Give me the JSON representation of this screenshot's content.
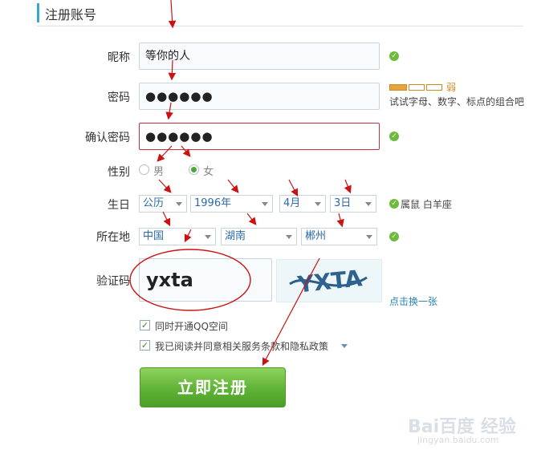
{
  "page_title": "注册账号",
  "fields": {
    "nickname": {
      "label": "昵称",
      "value": "等你的人"
    },
    "password": {
      "label": "密码",
      "value": "●●●●●●",
      "strength": "弱",
      "hint": "试试字母、数字、标点的组合吧"
    },
    "confirm": {
      "label": "确认密码",
      "value": "●●●●●●"
    },
    "gender": {
      "label": "性别",
      "options": [
        "男",
        "女"
      ],
      "selected": "女"
    },
    "birthday": {
      "label": "生日",
      "calendar": "公历",
      "year": "1996年",
      "month": "4月",
      "day": "3日",
      "zodiac": "属鼠 白羊座"
    },
    "location": {
      "label": "所在地",
      "country": "中国",
      "province": "湖南",
      "city": "郴州"
    },
    "captcha": {
      "label": "验证码",
      "value": "yxta",
      "image_text": "YXTA",
      "refresh": "点击换一张"
    }
  },
  "checkboxes": [
    {
      "label": "同时开通QQ空间",
      "checked": true
    },
    {
      "label": "我已阅读并同意相关服务条款和隐私政策",
      "checked": true
    }
  ],
  "submit_label": "立即注册",
  "watermark": {
    "brand": "Bai百度 经验",
    "url": "jingyan.baidu.com"
  },
  "colors": {
    "accent": "#3aa3d8",
    "ok": "#6cbb3c",
    "error": "#c9303a",
    "arrow": "#cc1111",
    "button": "#5fb236"
  }
}
